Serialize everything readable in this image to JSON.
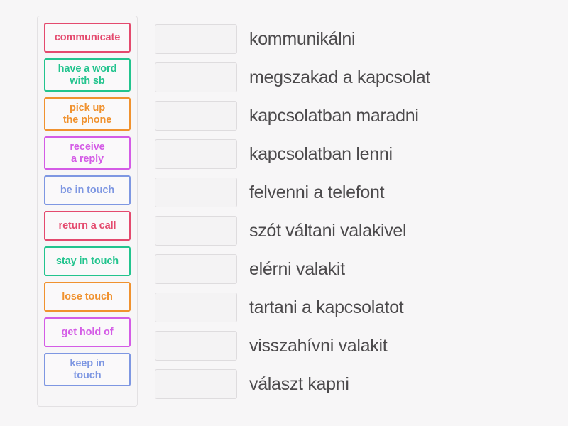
{
  "page": {
    "background_color": "#f7f6f7",
    "answer_text_color": "#4c4a4c"
  },
  "palette": {
    "crimson": "#e44a6e",
    "green": "#23c48e",
    "orange": "#f0922f",
    "purple": "#d45ce6",
    "blue": "#7e97e2"
  },
  "tiles_panel": {
    "tiles": [
      {
        "label": "communicate",
        "color": "#e44a6e",
        "lines": 1
      },
      {
        "label": "have a word\nwith sb",
        "color": "#23c48e",
        "lines": 2
      },
      {
        "label": "pick up\nthe phone",
        "color": "#f0922f",
        "lines": 2
      },
      {
        "label": "receive\na reply",
        "color": "#d45ce6",
        "lines": 2
      },
      {
        "label": "be in touch",
        "color": "#7e97e2",
        "lines": 1
      },
      {
        "label": "return a call",
        "color": "#e44a6e",
        "lines": 1
      },
      {
        "label": "stay in touch",
        "color": "#23c48e",
        "lines": 1
      },
      {
        "label": "lose touch",
        "color": "#f0922f",
        "lines": 1
      },
      {
        "label": "get hold of",
        "color": "#d45ce6",
        "lines": 1
      },
      {
        "label": "keep in\ntouch",
        "color": "#7e97e2",
        "lines": 2
      }
    ]
  },
  "answers": {
    "rows": [
      {
        "dropzone_value": "",
        "text": "kommunikálni"
      },
      {
        "dropzone_value": "",
        "text": "megszakad a kapcsolat"
      },
      {
        "dropzone_value": "",
        "text": "kapcsolatban maradni"
      },
      {
        "dropzone_value": "",
        "text": "kapcsolatban lenni"
      },
      {
        "dropzone_value": "",
        "text": "felvenni a telefont"
      },
      {
        "dropzone_value": "",
        "text": "szót váltani valakivel"
      },
      {
        "dropzone_value": "",
        "text": "elérni valakit"
      },
      {
        "dropzone_value": "",
        "text": "tartani a kapcsolatot"
      },
      {
        "dropzone_value": "",
        "text": "visszahívni valakit"
      },
      {
        "dropzone_value": "",
        "text": "választ kapni"
      }
    ]
  }
}
